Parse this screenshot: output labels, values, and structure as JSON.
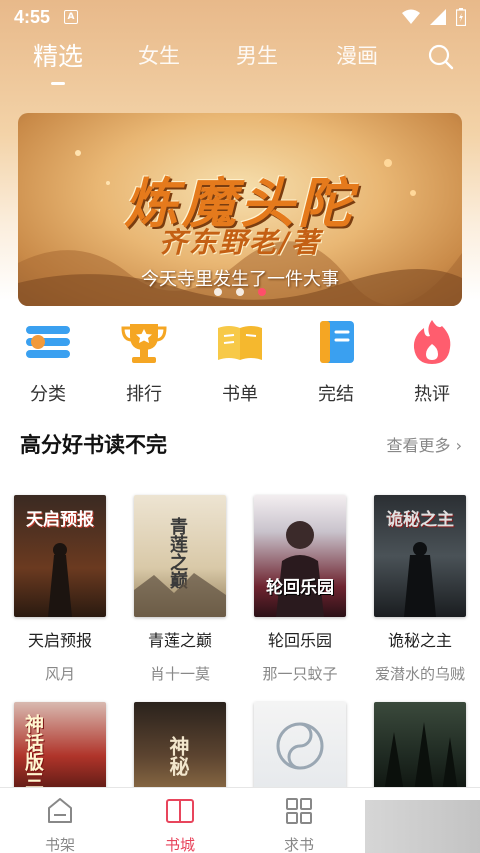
{
  "status": {
    "time": "4:55",
    "a_icon": "A"
  },
  "nav": {
    "tabs": [
      {
        "label": "精选",
        "active": true
      },
      {
        "label": "女生"
      },
      {
        "label": "男生"
      },
      {
        "label": "漫画"
      }
    ],
    "search_icon": "search-icon"
  },
  "banner": {
    "title": "炼魔头陀",
    "author_line": "齐东野老/著",
    "subtitle": "今天寺里发生了一件大事",
    "active_dot": 3,
    "dot_count": 3
  },
  "categories": [
    {
      "label": "分类",
      "icon": "list-icon"
    },
    {
      "label": "排行",
      "icon": "trophy-icon"
    },
    {
      "label": "书单",
      "icon": "book-open-icon"
    },
    {
      "label": "完结",
      "icon": "notebook-icon"
    },
    {
      "label": "热评",
      "icon": "flame-icon"
    }
  ],
  "section": {
    "title": "高分好书读不完",
    "more": "查看更多"
  },
  "books": [
    {
      "title": "天启预报",
      "author": "风月",
      "cover_text": "天启预报"
    },
    {
      "title": "青莲之巅",
      "author": "肖十一莫",
      "cover_text": "青莲之巅"
    },
    {
      "title": "轮回乐园",
      "author": "那一只蚊子",
      "cover_text": "轮回乐园"
    },
    {
      "title": "诡秘之主",
      "author": "爱潜水的乌贼",
      "cover_text": "诡秘之主"
    }
  ],
  "books_row2": [
    {
      "cover_text": "神话版三"
    },
    {
      "cover_text": "神秘"
    },
    {
      "cover_text": ""
    },
    {
      "cover_text": ""
    }
  ],
  "bottom_nav": [
    {
      "label": "书架",
      "icon": "bookshelf-icon"
    },
    {
      "label": "书城",
      "icon": "bookstore-icon",
      "active": true
    },
    {
      "label": "求书",
      "icon": "grid-icon"
    }
  ],
  "colors": {
    "accent": "#e8455c",
    "banner_title": "#e57a1c"
  }
}
